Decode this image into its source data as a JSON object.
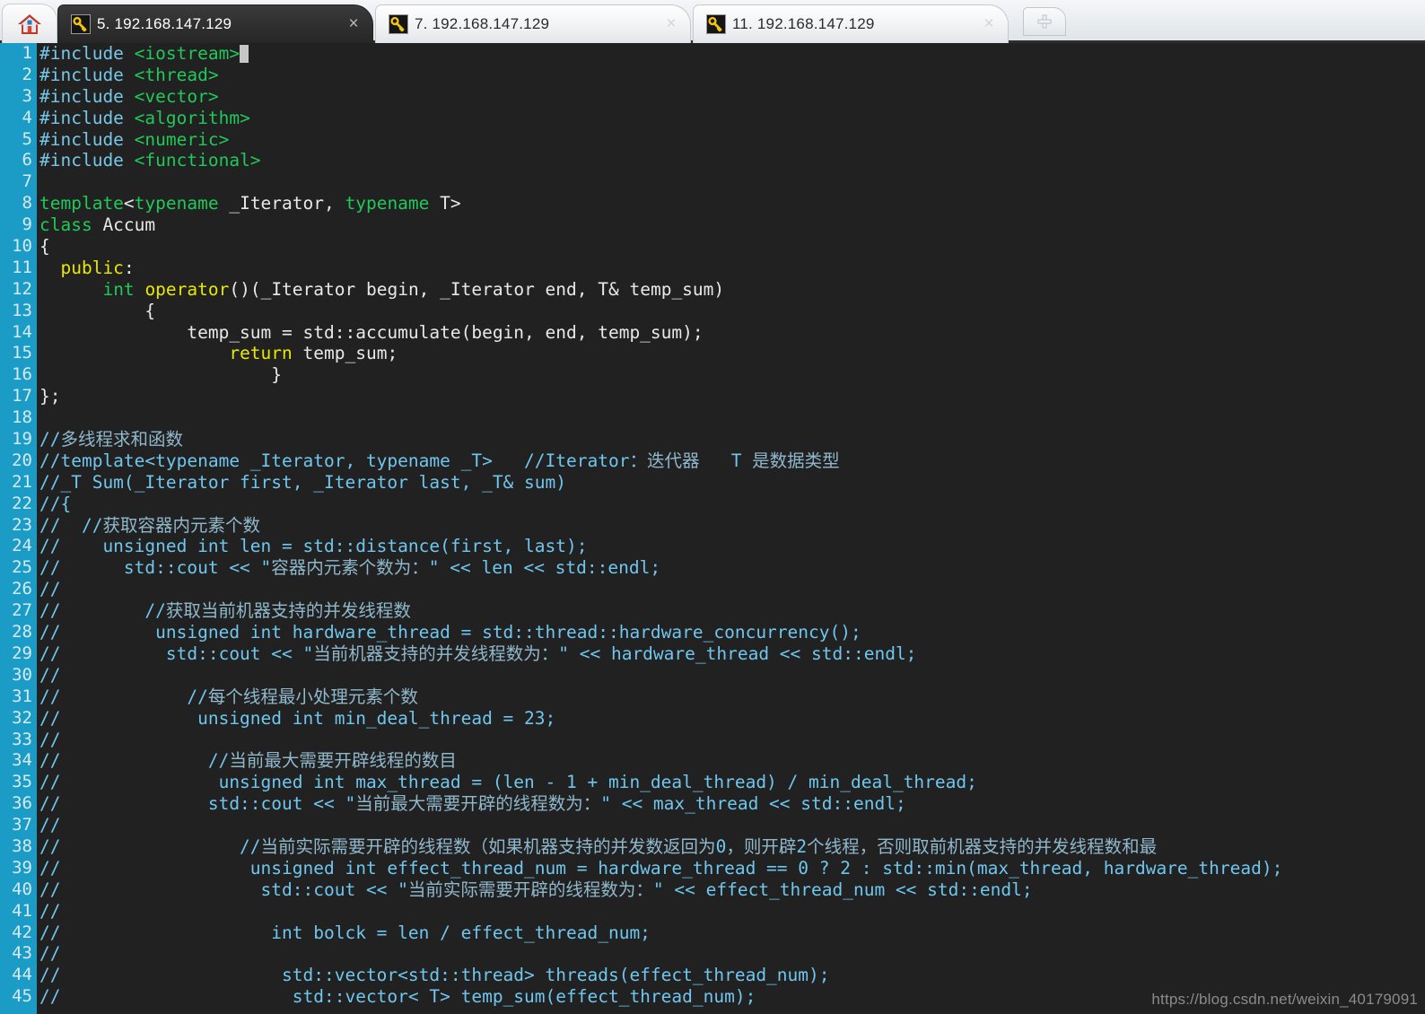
{
  "window": {
    "app": "ssh-terminal-editor",
    "home_button_icon": "house-icon",
    "new_tab_icon": "plus-icon"
  },
  "tabs": [
    {
      "icon": "key-icon",
      "label": "5. 192.168.147.129",
      "close": "×",
      "active": true
    },
    {
      "icon": "key-icon",
      "label": "7. 192.168.147.129",
      "close": "×",
      "active": false
    },
    {
      "icon": "key-icon",
      "label": "11. 192.168.147.129",
      "close": "×",
      "active": false
    }
  ],
  "editor": {
    "gutter_color": "#1a9cc7",
    "background_color": "#212121",
    "lines": [
      {
        "n": "1",
        "segs": [
          {
            "t": "#include ",
            "c": "c-pre"
          },
          {
            "t": "<iostream>",
            "c": "c-hdr"
          },
          {
            "t": "",
            "c": "cursor"
          }
        ]
      },
      {
        "n": "2",
        "segs": [
          {
            "t": "#include ",
            "c": "c-pre"
          },
          {
            "t": "<thread>",
            "c": "c-hdr"
          }
        ]
      },
      {
        "n": "3",
        "segs": [
          {
            "t": "#include ",
            "c": "c-pre"
          },
          {
            "t": "<vector>",
            "c": "c-hdr"
          }
        ]
      },
      {
        "n": "4",
        "segs": [
          {
            "t": "#include ",
            "c": "c-pre"
          },
          {
            "t": "<algorithm>",
            "c": "c-hdr"
          }
        ]
      },
      {
        "n": "5",
        "segs": [
          {
            "t": "#include ",
            "c": "c-pre"
          },
          {
            "t": "<numeric>",
            "c": "c-hdr"
          }
        ]
      },
      {
        "n": "6",
        "segs": [
          {
            "t": "#include ",
            "c": "c-pre"
          },
          {
            "t": "<functional>",
            "c": "c-hdr"
          }
        ]
      },
      {
        "n": "7",
        "segs": []
      },
      {
        "n": "8",
        "segs": [
          {
            "t": "template",
            "c": "c-kw"
          },
          {
            "t": "<",
            "c": "c-id"
          },
          {
            "t": "typename",
            "c": "c-kw"
          },
          {
            "t": " _Iterator, ",
            "c": "c-id"
          },
          {
            "t": "typename",
            "c": "c-kw"
          },
          {
            "t": " T>",
            "c": "c-id"
          }
        ]
      },
      {
        "n": "9",
        "segs": [
          {
            "t": "class",
            "c": "c-kw"
          },
          {
            "t": " Accum",
            "c": "c-id"
          }
        ]
      },
      {
        "n": "10",
        "segs": [
          {
            "t": "{",
            "c": "c-id"
          }
        ]
      },
      {
        "n": "11",
        "segs": [
          {
            "t": "  ",
            "c": "c-id"
          },
          {
            "t": "public",
            "c": "c-kw2"
          },
          {
            "t": ":",
            "c": "c-id"
          }
        ]
      },
      {
        "n": "12",
        "segs": [
          {
            "t": "      ",
            "c": "c-id"
          },
          {
            "t": "int",
            "c": "c-kw"
          },
          {
            "t": " ",
            "c": "c-id"
          },
          {
            "t": "operator",
            "c": "c-kw2"
          },
          {
            "t": "()(_Iterator begin, _Iterator end, T& temp_sum)",
            "c": "c-id"
          }
        ]
      },
      {
        "n": "13",
        "segs": [
          {
            "t": "          {",
            "c": "c-id"
          }
        ]
      },
      {
        "n": "14",
        "segs": [
          {
            "t": "              temp_sum = std::accumulate(begin, end, temp_sum);",
            "c": "c-id"
          }
        ]
      },
      {
        "n": "15",
        "segs": [
          {
            "t": "                  ",
            "c": "c-id"
          },
          {
            "t": "return",
            "c": "c-kw2"
          },
          {
            "t": " temp_sum;",
            "c": "c-id"
          }
        ]
      },
      {
        "n": "16",
        "segs": [
          {
            "t": "                      }",
            "c": "c-id"
          }
        ]
      },
      {
        "n": "17",
        "segs": [
          {
            "t": "};",
            "c": "c-id"
          }
        ]
      },
      {
        "n": "18",
        "segs": []
      },
      {
        "n": "19",
        "segs": [
          {
            "t": "//",
            "c": "c-cmt"
          },
          {
            "t": "多线程求和函数",
            "c": "c-cn"
          }
        ]
      },
      {
        "n": "20",
        "segs": [
          {
            "t": "//template<typename _Iterator, typename _T>   //Iterator：",
            "c": "c-cmt"
          },
          {
            "t": "迭代器",
            "c": "c-cn"
          },
          {
            "t": "   T ",
            "c": "c-cmt"
          },
          {
            "t": "是数据类型",
            "c": "c-cn"
          }
        ]
      },
      {
        "n": "21",
        "segs": [
          {
            "t": "//_T Sum(_Iterator first, _Iterator last, _T& sum)",
            "c": "c-cmt"
          }
        ]
      },
      {
        "n": "22",
        "segs": [
          {
            "t": "//{",
            "c": "c-cmt"
          }
        ]
      },
      {
        "n": "23",
        "segs": [
          {
            "t": "//  //",
            "c": "c-cmt"
          },
          {
            "t": "获取容器内元素个数",
            "c": "c-cn"
          }
        ]
      },
      {
        "n": "24",
        "segs": [
          {
            "t": "//    unsigned int len = std::distance(first, last);",
            "c": "c-cmt"
          }
        ]
      },
      {
        "n": "25",
        "segs": [
          {
            "t": "//      std::cout << \"",
            "c": "c-cmt"
          },
          {
            "t": "容器内元素个数为：",
            "c": "c-cn"
          },
          {
            "t": "\" << len << std::endl;",
            "c": "c-cmt"
          }
        ]
      },
      {
        "n": "26",
        "segs": [
          {
            "t": "//",
            "c": "c-cmt"
          }
        ]
      },
      {
        "n": "27",
        "segs": [
          {
            "t": "//        //",
            "c": "c-cmt"
          },
          {
            "t": "获取当前机器支持的并发线程数",
            "c": "c-cn"
          }
        ]
      },
      {
        "n": "28",
        "segs": [
          {
            "t": "//         unsigned int hardware_thread = std::thread::hardware_concurrency();",
            "c": "c-cmt"
          }
        ]
      },
      {
        "n": "29",
        "segs": [
          {
            "t": "//          std::cout << \"",
            "c": "c-cmt"
          },
          {
            "t": "当前机器支持的并发线程数为：",
            "c": "c-cn"
          },
          {
            "t": "\" << hardware_thread << std::endl;",
            "c": "c-cmt"
          }
        ]
      },
      {
        "n": "30",
        "segs": [
          {
            "t": "//",
            "c": "c-cmt"
          }
        ]
      },
      {
        "n": "31",
        "segs": [
          {
            "t": "//            //",
            "c": "c-cmt"
          },
          {
            "t": "每个线程最小处理元素个数",
            "c": "c-cn"
          }
        ]
      },
      {
        "n": "32",
        "segs": [
          {
            "t": "//             unsigned int min_deal_thread = 23;",
            "c": "c-cmt"
          }
        ]
      },
      {
        "n": "33",
        "segs": [
          {
            "t": "//",
            "c": "c-cmt"
          }
        ]
      },
      {
        "n": "34",
        "segs": [
          {
            "t": "//              //",
            "c": "c-cmt"
          },
          {
            "t": "当前最大需要开辟线程的数目",
            "c": "c-cn"
          }
        ]
      },
      {
        "n": "35",
        "segs": [
          {
            "t": "//               unsigned int max_thread = (len - 1 + min_deal_thread) / min_deal_thread;",
            "c": "c-cmt"
          }
        ]
      },
      {
        "n": "36",
        "segs": [
          {
            "t": "//              std::cout << \"",
            "c": "c-cmt"
          },
          {
            "t": "当前最大需要开辟的线程数为：",
            "c": "c-cn"
          },
          {
            "t": "\" << max_thread << std::endl;",
            "c": "c-cmt"
          }
        ]
      },
      {
        "n": "37",
        "segs": [
          {
            "t": "//",
            "c": "c-cmt"
          }
        ]
      },
      {
        "n": "38",
        "segs": [
          {
            "t": "//                 //",
            "c": "c-cmt"
          },
          {
            "t": "当前实际需要开辟的线程数（如果机器支持的并发数返回为",
            "c": "c-cn"
          },
          {
            "t": "0",
            "c": "c-cmt"
          },
          {
            "t": "，则开辟",
            "c": "c-cn"
          },
          {
            "t": "2",
            "c": "c-cmt"
          },
          {
            "t": "个线程，否则取前机器支持的并发线程数和最",
            "c": "c-cn"
          }
        ]
      },
      {
        "n": "39",
        "segs": [
          {
            "t": "//                  unsigned int effect_thread_num = hardware_thread == 0 ? 2 : std::min(max_thread, hardware_thread);",
            "c": "c-cmt"
          }
        ]
      },
      {
        "n": "40",
        "segs": [
          {
            "t": "//                   std::cout << \"",
            "c": "c-cmt"
          },
          {
            "t": "当前实际需要开辟的线程数为：",
            "c": "c-cn"
          },
          {
            "t": "\" << effect_thread_num << std::endl;",
            "c": "c-cmt"
          }
        ]
      },
      {
        "n": "41",
        "segs": [
          {
            "t": "//",
            "c": "c-cmt"
          }
        ]
      },
      {
        "n": "42",
        "segs": [
          {
            "t": "//                    int bolck = len / effect_thread_num;",
            "c": "c-cmt"
          }
        ]
      },
      {
        "n": "43",
        "segs": [
          {
            "t": "//",
            "c": "c-cmt"
          }
        ]
      },
      {
        "n": "44",
        "segs": [
          {
            "t": "//                     std::vector<std::thread> threads(effect_thread_num);",
            "c": "c-cmt"
          }
        ]
      },
      {
        "n": "45",
        "segs": [
          {
            "t": "//                      std::vector< T> temp_sum(effect_thread_num);",
            "c": "c-cmt"
          }
        ]
      }
    ]
  },
  "watermark": "https://blog.csdn.net/weixin_40179091"
}
